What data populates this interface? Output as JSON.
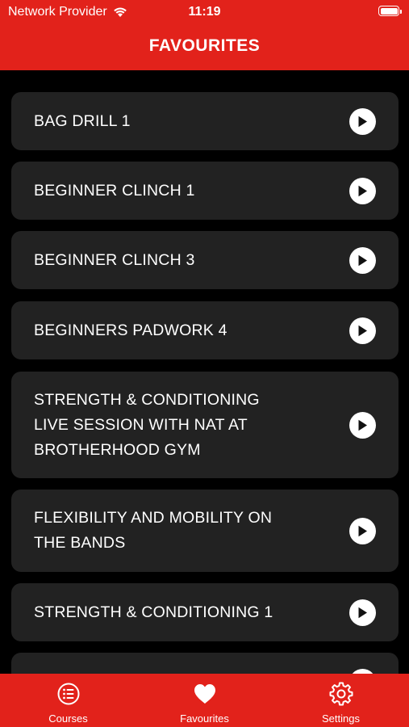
{
  "status": {
    "carrier": "Network Provider",
    "time": "11:19"
  },
  "header": {
    "title": "FAVOURITES"
  },
  "items": [
    {
      "title": "BAG DRILL 1"
    },
    {
      "title": "BEGINNER CLINCH 1"
    },
    {
      "title": "BEGINNER CLINCH 3"
    },
    {
      "title": "BEGINNERS PADWORK 4"
    },
    {
      "title": "STRENGTH & CONDITIONING\nLIVE SESSION WITH NAT AT\nBROTHERHOOD GYM"
    },
    {
      "title": "FLEXIBILITY AND MOBILITY ON\nTHE BANDS"
    },
    {
      "title": "STRENGTH & CONDITIONING 1"
    },
    {
      "title": ""
    }
  ],
  "tabs": [
    {
      "label": "Courses",
      "icon": "list-icon"
    },
    {
      "label": "Favourites",
      "icon": "heart-icon"
    },
    {
      "label": "Settings",
      "icon": "gear-icon"
    }
  ],
  "colors": {
    "accent": "#e2221b",
    "card": "#222222",
    "background": "#000000"
  }
}
